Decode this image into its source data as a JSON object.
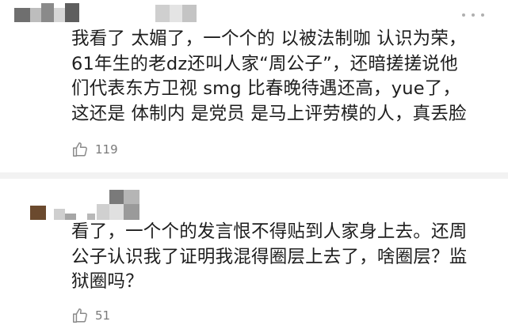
{
  "comments": [
    {
      "text": "我看了 太媚了，一个个的 以被法制咖 认识为荣，\n61年生的老dz还叫人家“周公子”，还暗搓搓说他\n们代表东方卫视 smg 比春晚待遇还高，yue了，\n这还是 体制内 是党员 是马上评劳模的人，真丢脸",
      "likes": "119",
      "like_icon": "thumbs-up-icon",
      "more_icon": "more-dots-icon"
    },
    {
      "text": "看了，一个个的发言恨不得贴到人家身上去。还周\n公子认识我了证明我混得圈层上去了，啥圈层？监\n狱圈吗？",
      "likes": "51",
      "like_icon": "thumbs-up-icon"
    }
  ],
  "colors": {
    "text": "#1e1e1e",
    "muted": "#7a7a7a",
    "divider": "#f2f2f2",
    "avatar_brown": "#6b4a2e"
  }
}
